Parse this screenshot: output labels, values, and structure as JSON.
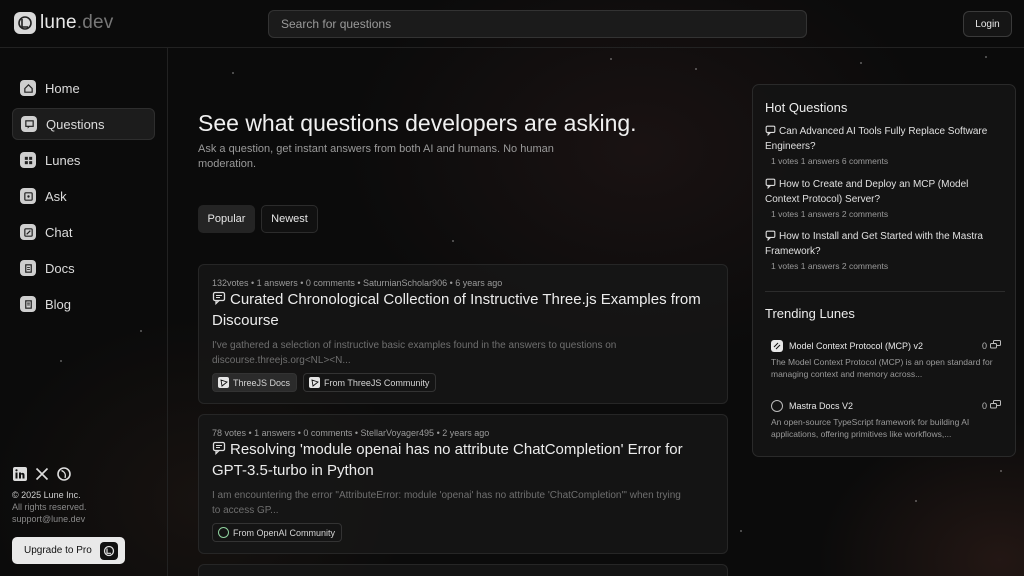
{
  "brand": {
    "name": "lune",
    "tld": ".dev"
  },
  "search": {
    "placeholder": "Search for questions",
    "value": ""
  },
  "header": {
    "login_label": "Login"
  },
  "sidebar": {
    "items": [
      {
        "label": "Home",
        "icon": "home-icon"
      },
      {
        "label": "Questions",
        "icon": "questions-icon",
        "active": true
      },
      {
        "label": "Lunes",
        "icon": "lunes-icon"
      },
      {
        "label": "Ask",
        "icon": "ask-icon"
      },
      {
        "label": "Chat",
        "icon": "chat-icon"
      },
      {
        "label": "Docs",
        "icon": "docs-icon"
      },
      {
        "label": "Blog",
        "icon": "blog-icon"
      }
    ],
    "social": [
      "linkedin-icon",
      "x-icon",
      "lune-icon"
    ],
    "copyright": "© 2025 Lune Inc.",
    "rights": "All rights reserved.",
    "email": "support@lune.dev",
    "upgrade_label": "Upgrade to Pro"
  },
  "main": {
    "headline": "See what questions developers are asking.",
    "subline": "Ask a question, get instant answers from both AI and humans. No human moderation.",
    "tabs": [
      {
        "label": "Popular",
        "active": true
      },
      {
        "label": "Newest"
      }
    ],
    "questions": [
      {
        "meta": "132votes • 1 answers • 0 comments • SaturnianScholar906 • 6 years ago",
        "title": "Curated Chronological Collection of Instructive Three.js Examples from Discourse",
        "excerpt": "I've gathered a selection of instructive basic examples found in the answers to questions on discourse.threejs.org<NL><N...",
        "chips": [
          "ThreeJS Docs",
          "From ThreeJS Community"
        ]
      },
      {
        "meta": "78 votes • 1 answers • 0 comments • StellarVoyager495 • 2 years ago",
        "title": "Resolving 'module openai has no attribute ChatCompletion' Error for GPT-3.5-turbo in Python",
        "excerpt": "I am encountering the error \"AttributeError: module 'openai' has no attribute 'ChatCompletion'\" when trying to access GP...",
        "chips": [
          "From OpenAI Community"
        ]
      }
    ]
  },
  "panel": {
    "hot_title": "Hot Questions",
    "hot": [
      {
        "title": "Can Advanced AI Tools Fully Replace Software Engineers?",
        "stats": "1  votes   1 answers   6 comments"
      },
      {
        "title": "How to Create and Deploy an MCP (Model Context Protocol) Server?",
        "stats": "1  votes   1 answers   2 comments"
      },
      {
        "title": "How to Install and Get Started with the Mastra Framework?",
        "stats": "1  votes   1 answers   2 comments"
      }
    ],
    "trending_title": "Trending Lunes",
    "trending": [
      {
        "name": "Model Context Protocol (MCP) v2",
        "count": "0",
        "desc": "The Model Context Protocol (MCP) is an open standard for managing context and memory across..."
      },
      {
        "name": "Mastra Docs V2",
        "count": "0",
        "desc": "An open-source TypeScript framework for building AI applications, offering primitives like workflows,..."
      }
    ]
  }
}
